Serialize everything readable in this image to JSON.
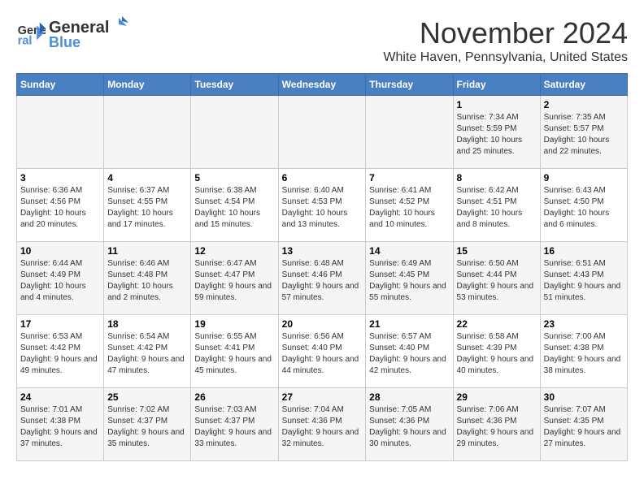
{
  "header": {
    "logo_line1": "General",
    "logo_line2": "Blue",
    "month_title": "November 2024",
    "location": "White Haven, Pennsylvania, United States"
  },
  "weekdays": [
    "Sunday",
    "Monday",
    "Tuesday",
    "Wednesday",
    "Thursday",
    "Friday",
    "Saturday"
  ],
  "weeks": [
    [
      {
        "day": "",
        "info": ""
      },
      {
        "day": "",
        "info": ""
      },
      {
        "day": "",
        "info": ""
      },
      {
        "day": "",
        "info": ""
      },
      {
        "day": "",
        "info": ""
      },
      {
        "day": "1",
        "info": "Sunrise: 7:34 AM\nSunset: 5:59 PM\nDaylight: 10 hours and 25 minutes."
      },
      {
        "day": "2",
        "info": "Sunrise: 7:35 AM\nSunset: 5:57 PM\nDaylight: 10 hours and 22 minutes."
      }
    ],
    [
      {
        "day": "3",
        "info": "Sunrise: 6:36 AM\nSunset: 4:56 PM\nDaylight: 10 hours and 20 minutes."
      },
      {
        "day": "4",
        "info": "Sunrise: 6:37 AM\nSunset: 4:55 PM\nDaylight: 10 hours and 17 minutes."
      },
      {
        "day": "5",
        "info": "Sunrise: 6:38 AM\nSunset: 4:54 PM\nDaylight: 10 hours and 15 minutes."
      },
      {
        "day": "6",
        "info": "Sunrise: 6:40 AM\nSunset: 4:53 PM\nDaylight: 10 hours and 13 minutes."
      },
      {
        "day": "7",
        "info": "Sunrise: 6:41 AM\nSunset: 4:52 PM\nDaylight: 10 hours and 10 minutes."
      },
      {
        "day": "8",
        "info": "Sunrise: 6:42 AM\nSunset: 4:51 PM\nDaylight: 10 hours and 8 minutes."
      },
      {
        "day": "9",
        "info": "Sunrise: 6:43 AM\nSunset: 4:50 PM\nDaylight: 10 hours and 6 minutes."
      }
    ],
    [
      {
        "day": "10",
        "info": "Sunrise: 6:44 AM\nSunset: 4:49 PM\nDaylight: 10 hours and 4 minutes."
      },
      {
        "day": "11",
        "info": "Sunrise: 6:46 AM\nSunset: 4:48 PM\nDaylight: 10 hours and 2 minutes."
      },
      {
        "day": "12",
        "info": "Sunrise: 6:47 AM\nSunset: 4:47 PM\nDaylight: 9 hours and 59 minutes."
      },
      {
        "day": "13",
        "info": "Sunrise: 6:48 AM\nSunset: 4:46 PM\nDaylight: 9 hours and 57 minutes."
      },
      {
        "day": "14",
        "info": "Sunrise: 6:49 AM\nSunset: 4:45 PM\nDaylight: 9 hours and 55 minutes."
      },
      {
        "day": "15",
        "info": "Sunrise: 6:50 AM\nSunset: 4:44 PM\nDaylight: 9 hours and 53 minutes."
      },
      {
        "day": "16",
        "info": "Sunrise: 6:51 AM\nSunset: 4:43 PM\nDaylight: 9 hours and 51 minutes."
      }
    ],
    [
      {
        "day": "17",
        "info": "Sunrise: 6:53 AM\nSunset: 4:42 PM\nDaylight: 9 hours and 49 minutes."
      },
      {
        "day": "18",
        "info": "Sunrise: 6:54 AM\nSunset: 4:42 PM\nDaylight: 9 hours and 47 minutes."
      },
      {
        "day": "19",
        "info": "Sunrise: 6:55 AM\nSunset: 4:41 PM\nDaylight: 9 hours and 45 minutes."
      },
      {
        "day": "20",
        "info": "Sunrise: 6:56 AM\nSunset: 4:40 PM\nDaylight: 9 hours and 44 minutes."
      },
      {
        "day": "21",
        "info": "Sunrise: 6:57 AM\nSunset: 4:40 PM\nDaylight: 9 hours and 42 minutes."
      },
      {
        "day": "22",
        "info": "Sunrise: 6:58 AM\nSunset: 4:39 PM\nDaylight: 9 hours and 40 minutes."
      },
      {
        "day": "23",
        "info": "Sunrise: 7:00 AM\nSunset: 4:38 PM\nDaylight: 9 hours and 38 minutes."
      }
    ],
    [
      {
        "day": "24",
        "info": "Sunrise: 7:01 AM\nSunset: 4:38 PM\nDaylight: 9 hours and 37 minutes."
      },
      {
        "day": "25",
        "info": "Sunrise: 7:02 AM\nSunset: 4:37 PM\nDaylight: 9 hours and 35 minutes."
      },
      {
        "day": "26",
        "info": "Sunrise: 7:03 AM\nSunset: 4:37 PM\nDaylight: 9 hours and 33 minutes."
      },
      {
        "day": "27",
        "info": "Sunrise: 7:04 AM\nSunset: 4:36 PM\nDaylight: 9 hours and 32 minutes."
      },
      {
        "day": "28",
        "info": "Sunrise: 7:05 AM\nSunset: 4:36 PM\nDaylight: 9 hours and 30 minutes."
      },
      {
        "day": "29",
        "info": "Sunrise: 7:06 AM\nSunset: 4:36 PM\nDaylight: 9 hours and 29 minutes."
      },
      {
        "day": "30",
        "info": "Sunrise: 7:07 AM\nSunset: 4:35 PM\nDaylight: 9 hours and 27 minutes."
      }
    ]
  ]
}
